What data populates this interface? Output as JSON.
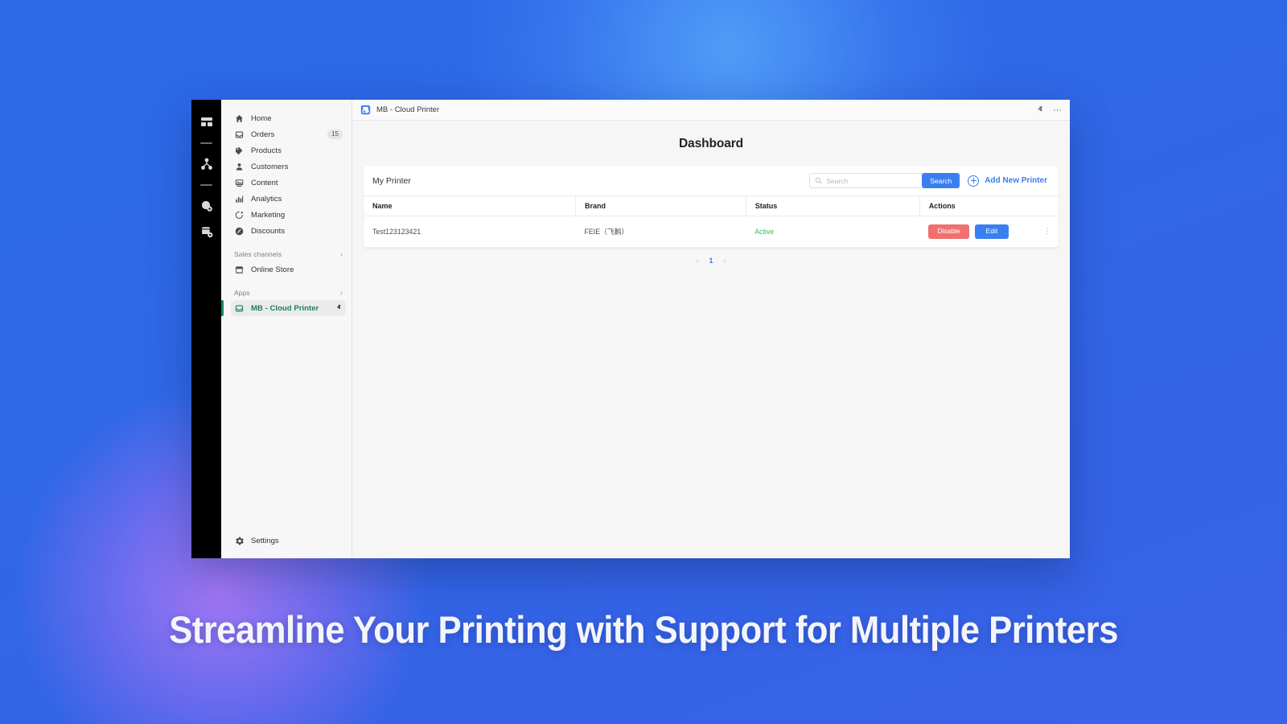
{
  "background": {
    "base_color": "#2a6ae8",
    "glow_blue": "#56a5fa",
    "glow_purple": "#a878f5"
  },
  "caption": {
    "text": "Streamline Your Printing with Support for Multiple Printers",
    "color": "#f4f5fa"
  },
  "dark_rail": {
    "items": [
      {
        "icon": "dashboard-grid-icon"
      },
      {
        "icon": "divider"
      },
      {
        "icon": "sitemap-icon"
      },
      {
        "icon": "divider"
      },
      {
        "icon": "globe-settings-icon"
      },
      {
        "icon": "store-settings-icon"
      }
    ]
  },
  "sidebar": {
    "items": [
      {
        "label": "Home",
        "icon": "home-icon",
        "badge": ""
      },
      {
        "label": "Orders",
        "icon": "orders-inbox-icon",
        "badge": "15"
      },
      {
        "label": "Products",
        "icon": "products-tag-icon",
        "badge": ""
      },
      {
        "label": "Customers",
        "icon": "customers-person-icon",
        "badge": ""
      },
      {
        "label": "Content",
        "icon": "content-media-icon",
        "badge": ""
      },
      {
        "label": "Analytics",
        "icon": "analytics-bars-icon",
        "badge": ""
      },
      {
        "label": "Marketing",
        "icon": "marketing-megaphone-icon",
        "badge": ""
      },
      {
        "label": "Discounts",
        "icon": "discounts-percent-icon",
        "badge": ""
      }
    ],
    "sections": [
      {
        "label": "Sales channels",
        "chevron": "›"
      },
      {
        "label": "Apps",
        "chevron": "›"
      }
    ],
    "online_store": {
      "label": "Online Store",
      "icon": "store-icon"
    },
    "active_app": {
      "label": "MB - Cloud Printer",
      "icon": "printer-icon",
      "pin_icon": "pin-icon",
      "accent_color": "#108a5b"
    },
    "settings": {
      "label": "Settings",
      "icon": "gear-icon"
    }
  },
  "appbar": {
    "title": "MB - Cloud Printer",
    "app_icon": "cloud-printer-app-icon",
    "pin_icon": "pin-icon",
    "more_icon": "ellipsis-horizontal-icon"
  },
  "page": {
    "title": "Dashboard"
  },
  "card": {
    "title": "My Printer",
    "search": {
      "placeholder": "Search",
      "value": "",
      "icon": "search-icon",
      "button_label": "Search"
    },
    "add_printer": {
      "label": "Add New Printer",
      "icon": "plus-circle-icon",
      "color": "#3a7ff0"
    },
    "table": {
      "columns": [
        "Name",
        "Brand",
        "Status",
        "Actions"
      ],
      "rows": [
        {
          "name": "Test123123421",
          "brand": "FEIE（飞鹅）",
          "status": "Active",
          "status_color": "#30c24d",
          "actions": {
            "disable_label": "Disable",
            "edit_label": "Edit",
            "kebab_icon": "ellipsis-vertical-icon"
          }
        }
      ]
    },
    "pagination": {
      "prev": "‹",
      "current": "1",
      "next": "›"
    }
  }
}
